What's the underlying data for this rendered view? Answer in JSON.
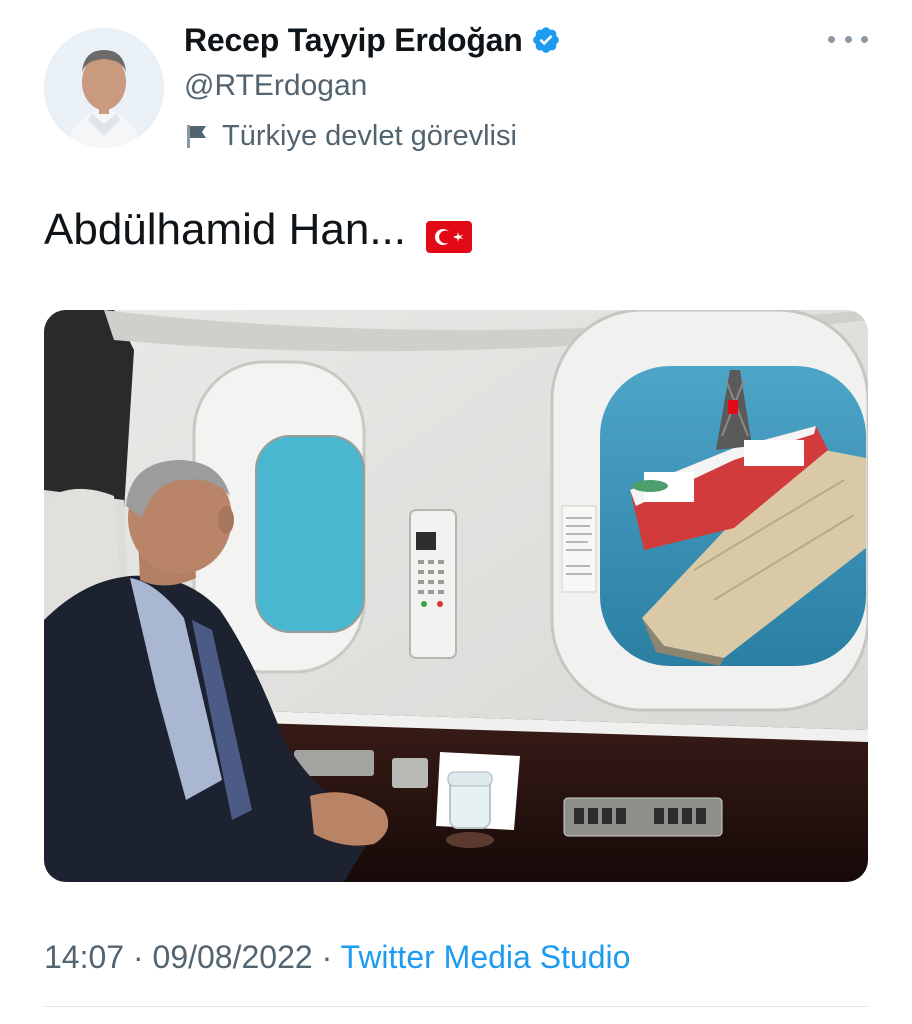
{
  "author": {
    "display_name": "Recep Tayyip Erdoğan",
    "handle": "@RTErdogan",
    "label": "Türkiye devlet görevlisi",
    "verified_icon": "verified-badge-icon",
    "label_icon": "flag-icon"
  },
  "tweet": {
    "text": "Abdülhamid Han...",
    "emoji_icon": "turkey-flag-icon"
  },
  "meta": {
    "time": "14:07",
    "separator": "·",
    "date": "09/08/2022",
    "source": "Twitter Media Studio"
  },
  "colors": {
    "text_primary": "#0f1419",
    "text_secondary": "#536471",
    "accent": "#1d9bf0"
  }
}
